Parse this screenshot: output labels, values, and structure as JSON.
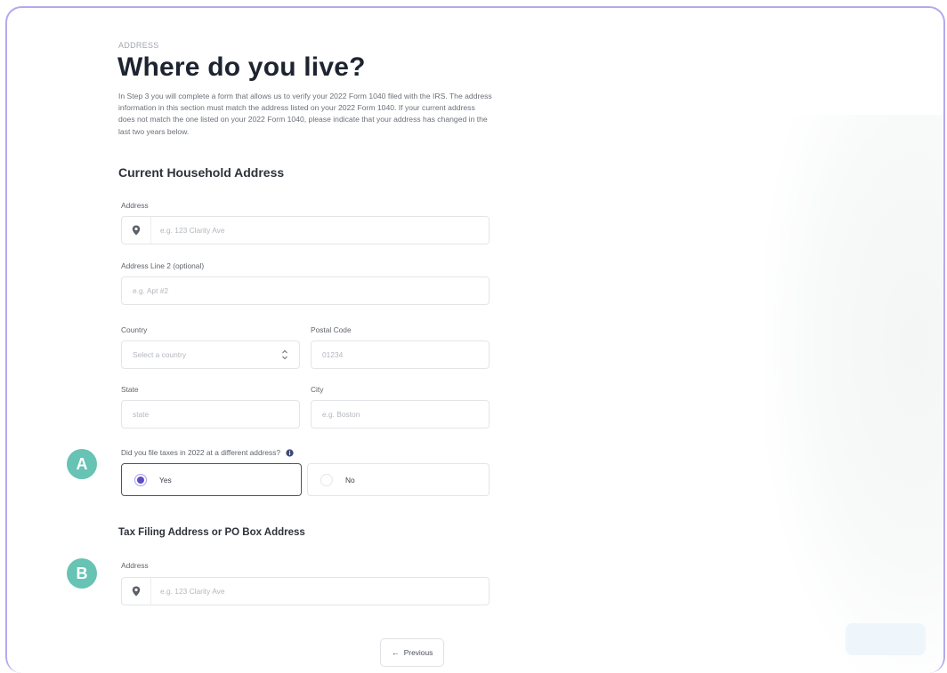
{
  "header": {
    "eyebrow": "ADDRESS",
    "title": "Where do you live?",
    "intro": "In Step 3 you will complete a form that allows us to verify your 2022 Form 1040 filed with the IRS. The address information in this section must match the address listed on your 2022 Form 1040. If your current address does not match the one listed on your 2022 Form 1040, please indicate that your address has changed in the last two years below."
  },
  "current_address": {
    "section_title": "Current Household Address",
    "address_label": "Address",
    "address_placeholder": "e.g. 123 Clarity Ave",
    "address2_label": "Address Line 2 (optional)",
    "address2_placeholder": "e.g. Apt #2",
    "country_label": "Country",
    "country_value": "Select a country",
    "postal_label": "Postal Code",
    "postal_placeholder": "01234",
    "state_label": "State",
    "state_placeholder": "state",
    "city_label": "City",
    "city_placeholder": "e.g. Boston"
  },
  "different_address": {
    "question": "Did you file taxes in 2022 at a different address?",
    "options": [
      {
        "label": "Yes",
        "selected": true
      },
      {
        "label": "No",
        "selected": false
      }
    ]
  },
  "tax_address": {
    "section_title": "Tax Filing Address or PO Box Address",
    "address_label": "Address",
    "address_placeholder": "e.g. 123 Clarity Ave"
  },
  "annotations": {
    "a": "A",
    "b": "B"
  },
  "footer": {
    "previous_label": "Previous"
  },
  "icons": {
    "location": "location-pin-icon",
    "info": "info-icon",
    "select": "chevron-up-down-icon",
    "back": "arrow-left-icon"
  },
  "colors": {
    "frame_border": "#b7a7ee",
    "radio_accent": "#5b4ec2",
    "badge": "#67c3b3"
  }
}
